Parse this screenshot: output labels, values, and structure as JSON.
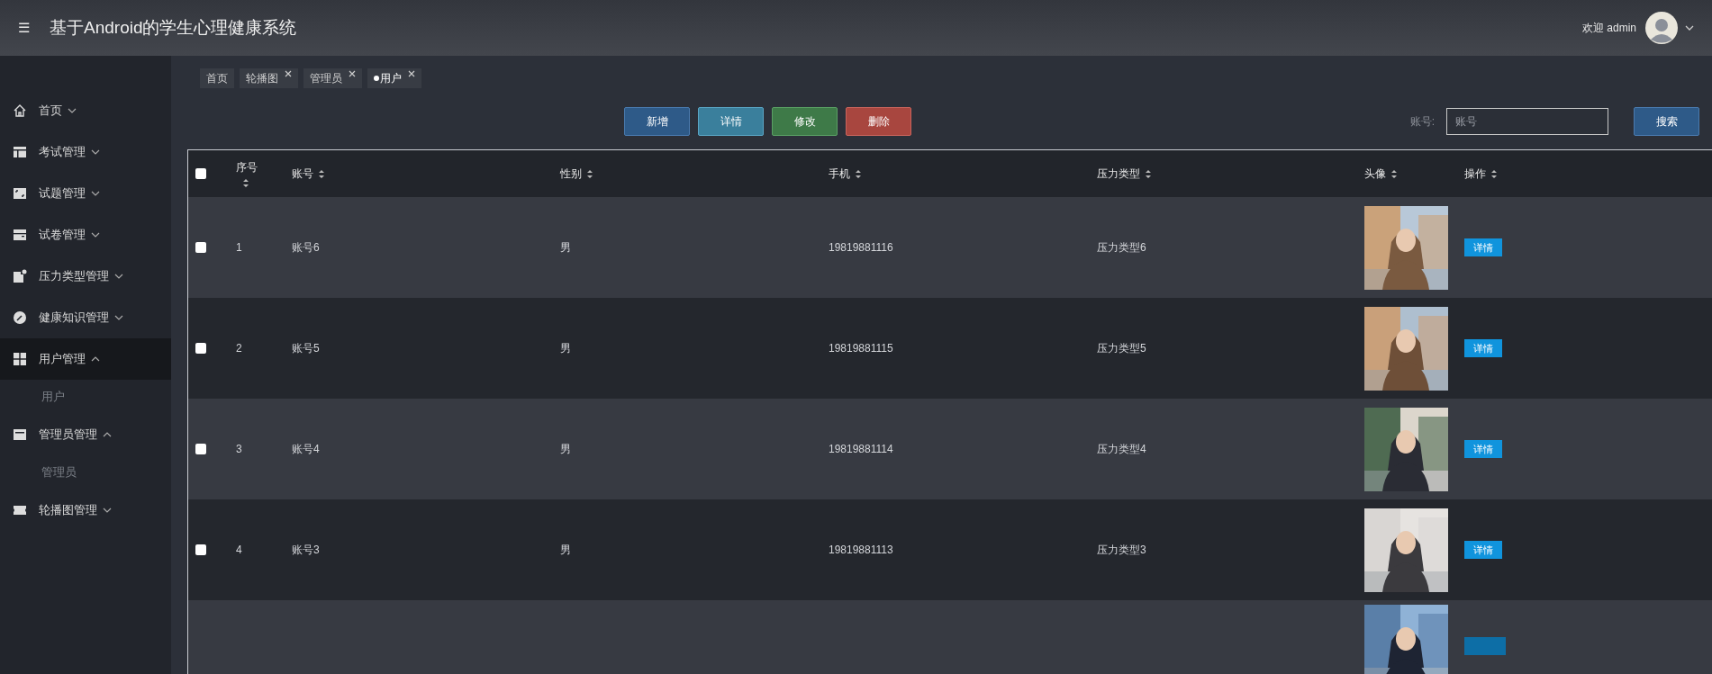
{
  "header": {
    "menu_icon": "☰",
    "title": "基于Android的学生心理健康系统",
    "welcome": "欢迎 admin"
  },
  "sidebar": {
    "items": [
      {
        "label": "首页",
        "expanded": false,
        "selected": false
      },
      {
        "label": "考试管理",
        "expanded": false,
        "selected": false
      },
      {
        "label": "试题管理",
        "expanded": false,
        "selected": false
      },
      {
        "label": "试卷管理",
        "expanded": false,
        "selected": false
      },
      {
        "label": "压力类型管理",
        "expanded": false,
        "selected": false
      },
      {
        "label": "健康知识管理",
        "expanded": false,
        "selected": false
      },
      {
        "label": "用户管理",
        "expanded": true,
        "selected": true,
        "children": [
          {
            "label": "用户"
          }
        ]
      },
      {
        "label": "管理员管理",
        "expanded": true,
        "selected": false,
        "children": [
          {
            "label": "管理员"
          }
        ]
      },
      {
        "label": "轮播图管理",
        "expanded": false,
        "selected": false
      }
    ]
  },
  "tabs": [
    {
      "label": "首页",
      "closable": false,
      "selected": false
    },
    {
      "label": "轮播图",
      "closable": true,
      "selected": false
    },
    {
      "label": "管理员",
      "closable": true,
      "selected": false
    },
    {
      "label": "用户",
      "closable": true,
      "selected": true
    }
  ],
  "toolbar": {
    "buttons": [
      {
        "label": "新增",
        "kind": "add"
      },
      {
        "label": "详情",
        "kind": "detail"
      },
      {
        "label": "修改",
        "kind": "edit"
      },
      {
        "label": "删除",
        "kind": "delete"
      }
    ],
    "search_label": "账号:",
    "search_placeholder": "账号",
    "search_button": "搜索"
  },
  "table": {
    "select_all_checked": false,
    "columns": [
      "序号",
      "账号",
      "性别",
      "手机",
      "压力类型",
      "头像",
      "操作"
    ],
    "rows": [
      {
        "checked": false,
        "index": "1",
        "account": "账号6",
        "gender": "男",
        "phone": "19819881116",
        "stress_type": "压力类型6",
        "avatar": {
          "kind": "picture"
        },
        "action": "详情"
      },
      {
        "checked": false,
        "index": "2",
        "account": "账号5",
        "gender": "男",
        "phone": "19819881115",
        "stress_type": "压力类型5",
        "avatar": {
          "kind": "picture"
        },
        "action": "详情"
      },
      {
        "checked": false,
        "index": "3",
        "account": "账号4",
        "gender": "男",
        "phone": "19819881114",
        "stress_type": "压力类型4",
        "avatar": {
          "kind": "picture"
        },
        "action": "详情"
      },
      {
        "checked": false,
        "index": "4",
        "account": "账号3",
        "gender": "男",
        "phone": "19819881113",
        "stress_type": "压力类型3",
        "avatar": {
          "kind": "picture"
        },
        "action": "详情"
      },
      {
        "avatar": {
          "kind": "picture"
        }
      }
    ]
  }
}
